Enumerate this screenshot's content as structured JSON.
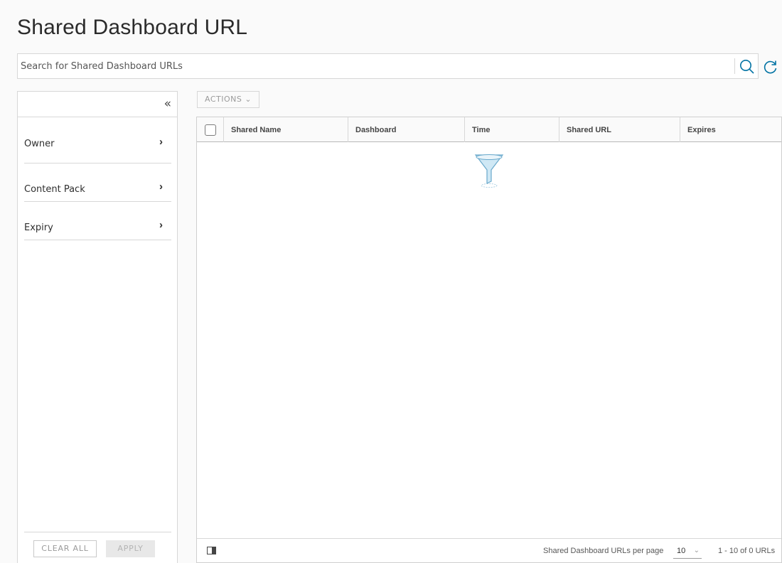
{
  "page": {
    "title": "Shared Dashboard URL"
  },
  "search": {
    "placeholder": "Search for Shared Dashboard URLs",
    "value": "",
    "search_icon": "search-icon",
    "refresh_icon": "refresh-icon"
  },
  "filters": {
    "collapse_icon": "collapse-left-icon",
    "collapse_glyph": "«",
    "items": [
      {
        "label": "Owner",
        "chevron": "›"
      },
      {
        "label": "Content Pack",
        "chevron": "›"
      },
      {
        "label": "Expiry",
        "chevron": "›"
      }
    ],
    "clear_all_label": "CLEAR ALL",
    "apply_label": "APPLY"
  },
  "toolbar": {
    "actions_label": "ACTIONS ⌄"
  },
  "grid": {
    "columns": [
      "Shared Name",
      "Dashboard",
      "Time",
      "Shared URL",
      "Expires"
    ],
    "rows": [],
    "empty_icon": "empty-filter-icon"
  },
  "pagination": {
    "per_page_label": "Shared Dashboard URLs per page",
    "per_page_value": "10",
    "count_text": "1 - 10 of 0 URLs"
  },
  "colors": {
    "accent": "#0072a3",
    "border": "#d7d7d7",
    "background": "#fafafa"
  }
}
